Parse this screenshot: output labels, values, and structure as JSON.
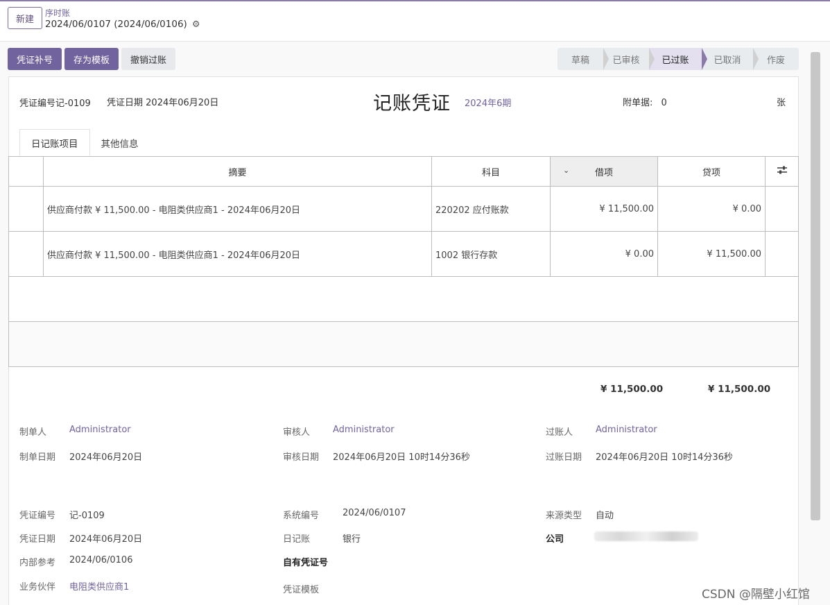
{
  "breadcrumb": {
    "parent": "序时账",
    "current": "2024/06/0107 (2024/06/0106)"
  },
  "control": {
    "new_label": "新建"
  },
  "actions": {
    "renumber": "凭证补号",
    "save_template": "存为模板",
    "unpost": "撤销过账"
  },
  "statusbar": {
    "items": [
      "草稿",
      "已审核",
      "已过账",
      "已取消",
      "作废"
    ],
    "active": "已过账"
  },
  "header": {
    "voucher_no_label": "凭证编号",
    "voucher_no": "记-0109",
    "voucher_date_label": "凭证日期",
    "voucher_date": "2024年06月20日",
    "title": "记账凭证",
    "period": "2024年6期",
    "attachments_label": "附单据:",
    "attachments": "0",
    "attachments_unit": "张"
  },
  "tabs": [
    "日记账项目",
    "其他信息"
  ],
  "table": {
    "columns": [
      "摘要",
      "科目",
      "借项",
      "贷项"
    ],
    "rows": [
      {
        "memo": "供应商付款 ¥ 11,500.00 - 电阻类供应商1 - 2024年06月20日",
        "account": "220202 应付账款",
        "debit": "¥ 11,500.00",
        "credit": "¥ 0.00"
      },
      {
        "memo": "供应商付款 ¥ 11,500.00 - 电阻类供应商1 - 2024年06月20日",
        "account": "1002 银行存款",
        "debit": "¥ 0.00",
        "credit": "¥ 11,500.00"
      }
    ],
    "total_debit": "¥ 11,500.00",
    "total_credit": "¥ 11,500.00"
  },
  "fields": {
    "preparer_label": "制单人",
    "preparer": "Administrator",
    "prep_date_label": "制单日期",
    "prep_date": "2024年06月20日",
    "reviewer_label": "审核人",
    "reviewer": "Administrator",
    "review_date_label": "审核日期",
    "review_date": "2024年06月20日 10时14分36秒",
    "poster_label": "过账人",
    "poster": "Administrator",
    "post_date_label": "过账日期",
    "post_date": "2024年06月20日 10时14分36秒",
    "voucher_no_label": "凭证编号",
    "voucher_no": "记-0109",
    "voucher_date_label": "凭证日期",
    "voucher_date": "2024年06月20日",
    "internal_ref_label": "内部参考",
    "internal_ref": "2024/06/0106",
    "partner_label": "业务伙伴",
    "partner": "电阻类供应商1",
    "system_no_label": "系统编号",
    "system_no": "2024/06/0107",
    "journal_label": "日记账",
    "journal": "银行",
    "own_voucher_label": "自有凭证号",
    "template_label": "凭证模板",
    "source_type_label": "来源类型",
    "source_type": "自动",
    "company_label": "公司"
  },
  "watermark": "CSDN @隔壁小红馆",
  "colors": {
    "primary": "#71639e",
    "border": "#bdbdbd"
  },
  "icons": {
    "settings": "gear-icon",
    "sort": "chevron-down-icon",
    "column_options": "sliders-icon"
  }
}
